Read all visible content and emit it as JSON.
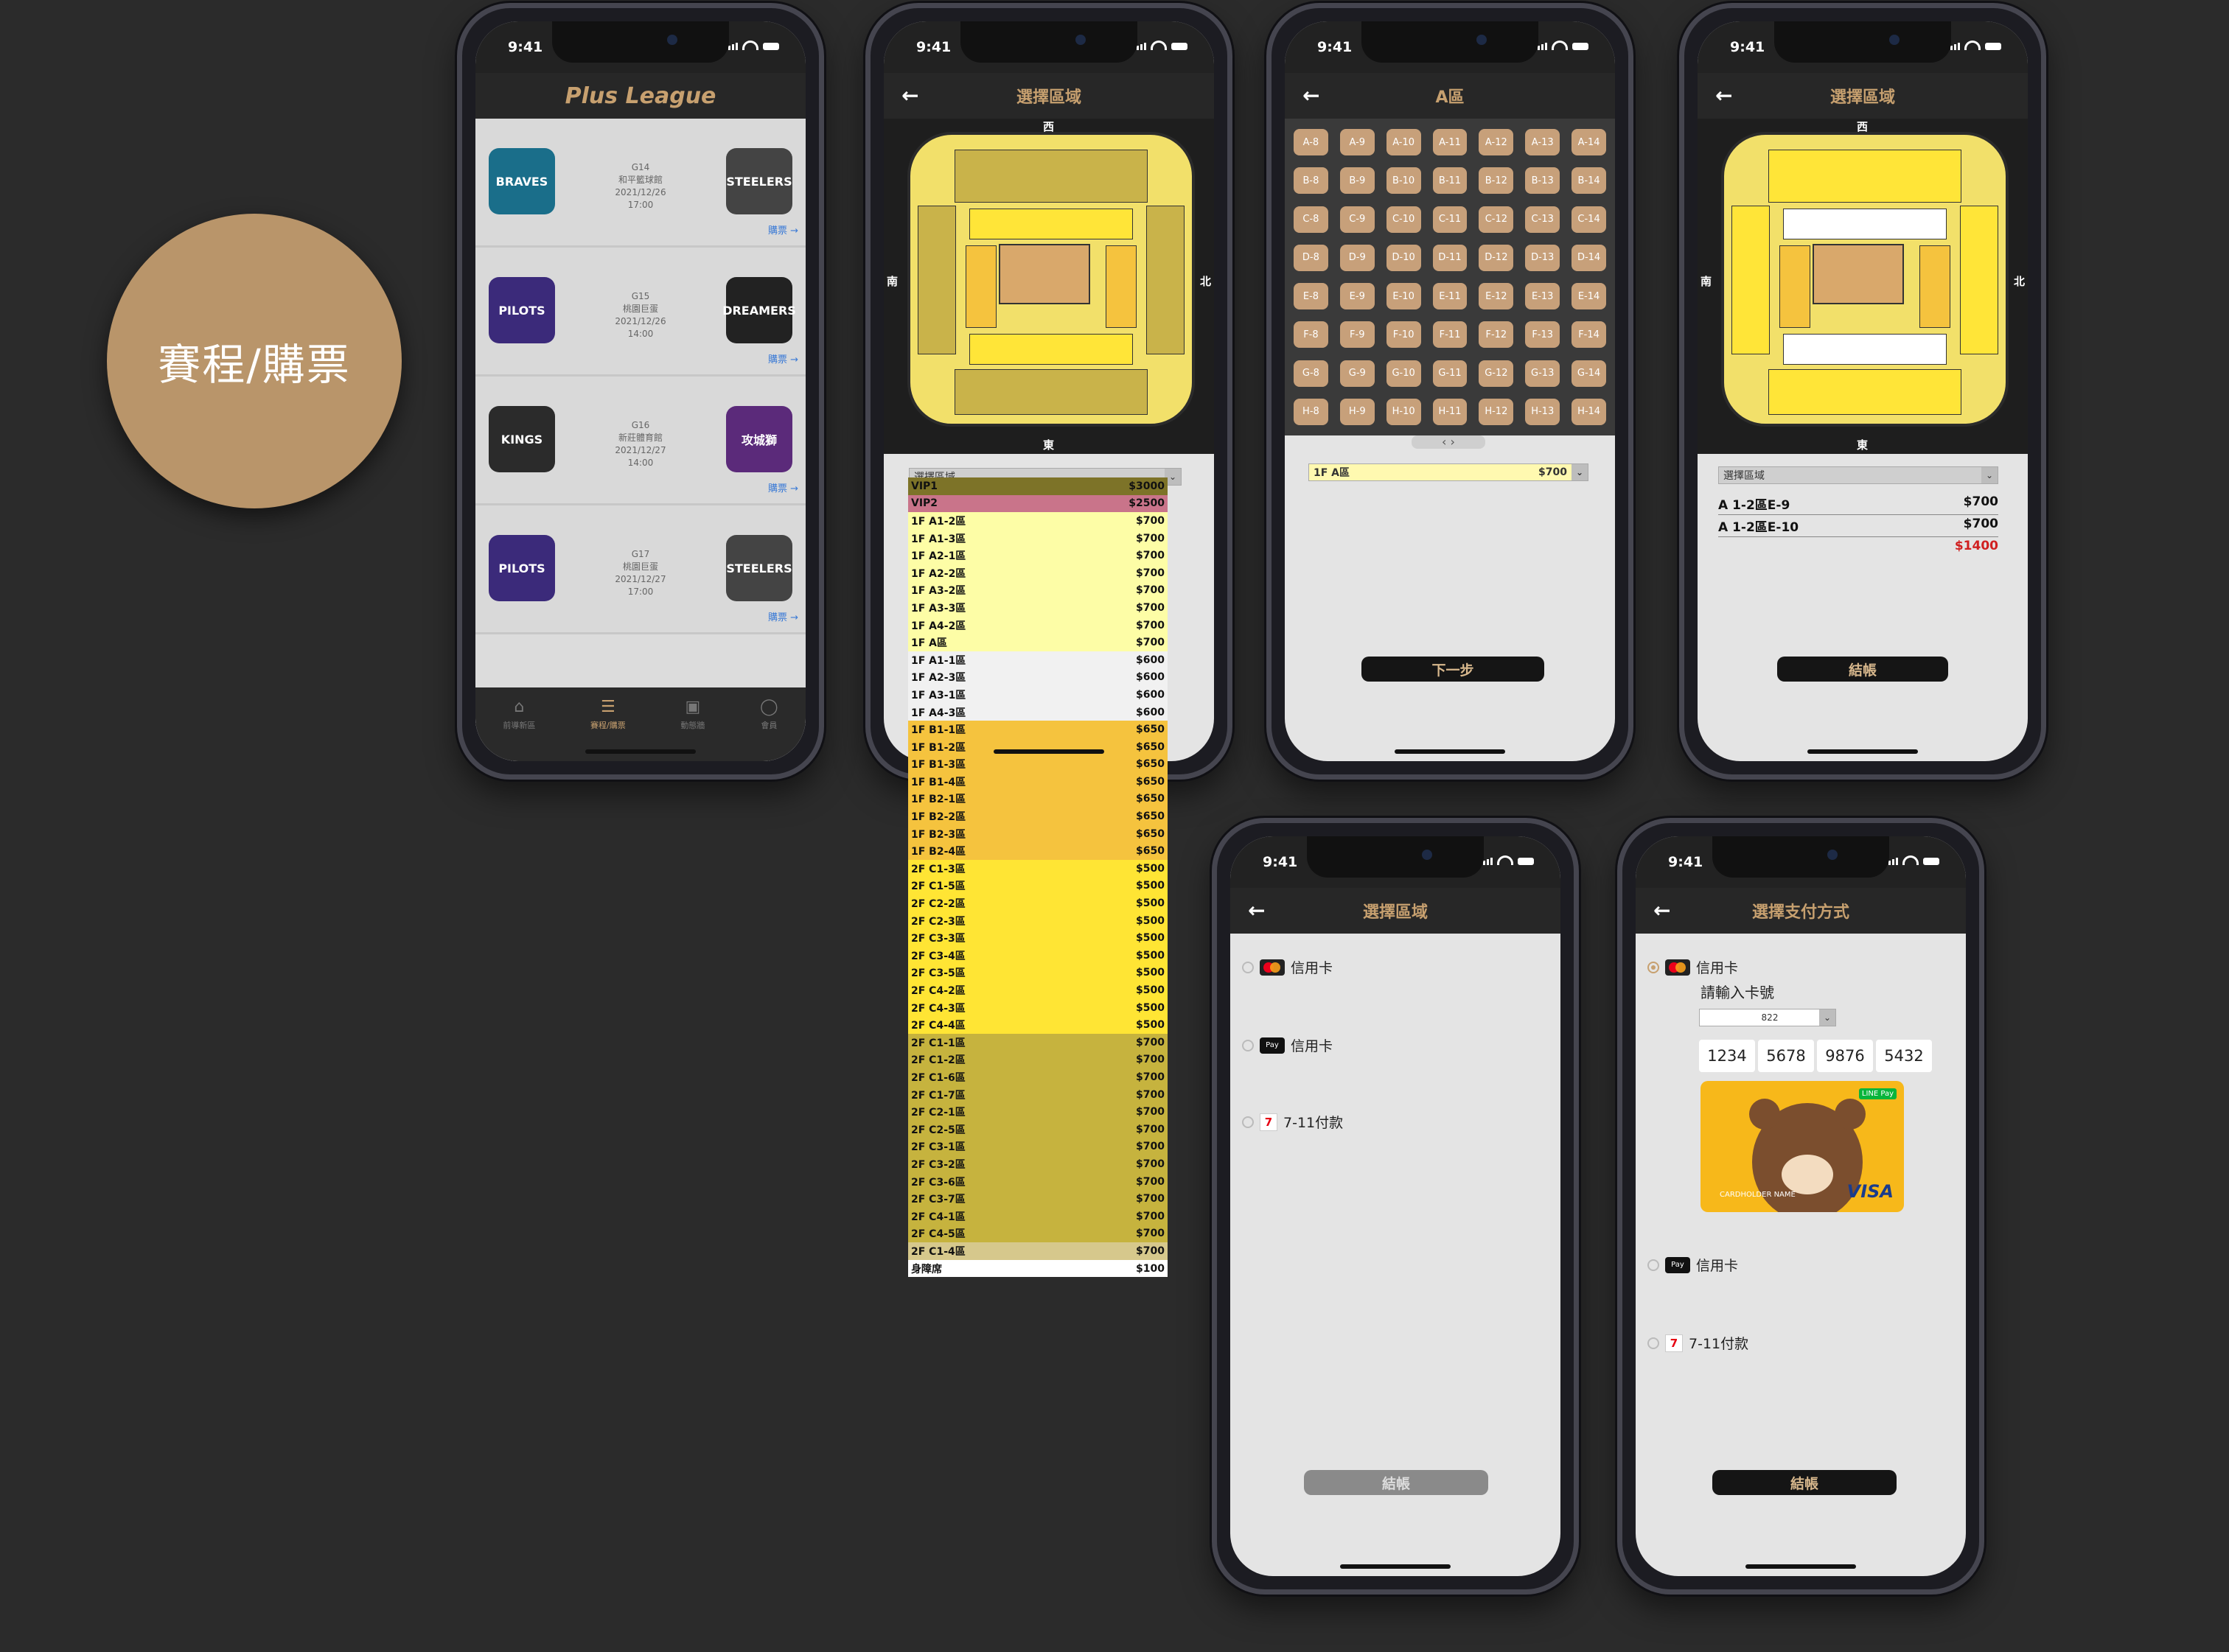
{
  "section_title": "賽程/購票",
  "status_time": "9:41",
  "schedule": {
    "title": "Plus League",
    "buy_label": "購票 →",
    "games": [
      {
        "code": "G14",
        "venue": "和平籃球館",
        "date": "2021/12/26",
        "time": "17:00",
        "home": "BRAVES",
        "away": "STEELERS",
        "home_color": "#1a6e8a",
        "away_color": "#444"
      },
      {
        "code": "G15",
        "venue": "桃園巨蛋",
        "date": "2021/12/26",
        "time": "14:00",
        "home": "PILOTS",
        "away": "DREAMERS",
        "home_color": "#3b2a7a",
        "away_color": "#222"
      },
      {
        "code": "G16",
        "venue": "新莊體育館",
        "date": "2021/12/27",
        "time": "14:00",
        "home": "KINGS",
        "away": "攻城獅",
        "home_color": "#2b2b2b",
        "away_color": "#5b2a7a"
      },
      {
        "code": "G17",
        "venue": "桃園巨蛋",
        "date": "2021/12/27",
        "time": "17:00",
        "home": "PILOTS",
        "away": "STEELERS",
        "home_color": "#3b2a7a",
        "away_color": "#444"
      }
    ],
    "tabs": [
      "前導新區",
      "賽程/購票",
      "動態牆",
      "會員"
    ]
  },
  "zone_select": {
    "title": "選擇區域",
    "dir_west": "西",
    "dir_east": "東",
    "dir_south": "南",
    "dir_north": "北",
    "dropdown": "選擇區域",
    "prices": [
      {
        "name": "VIP1",
        "price": "$3000",
        "color": "#7d7328"
      },
      {
        "name": "VIP2",
        "price": "$2500",
        "color": "#c9748a"
      },
      {
        "name": "1F A1-2區",
        "price": "$700",
        "color": "#fdfda6"
      },
      {
        "name": "1F A1-3區",
        "price": "$700",
        "color": "#fdfda6"
      },
      {
        "name": "1F A2-1區",
        "price": "$700",
        "color": "#fdfda6"
      },
      {
        "name": "1F A2-2區",
        "price": "$700",
        "color": "#fdfda6"
      },
      {
        "name": "1F A3-2區",
        "price": "$700",
        "color": "#fdfda6"
      },
      {
        "name": "1F A3-3區",
        "price": "$700",
        "color": "#fdfda6"
      },
      {
        "name": "1F A4-2區",
        "price": "$700",
        "color": "#fdfda6"
      },
      {
        "name": "1F A區",
        "price": "$700",
        "color": "#fdfda6"
      },
      {
        "name": "1F A1-1區",
        "price": "$600",
        "color": "#f1f1f1"
      },
      {
        "name": "1F A2-3區",
        "price": "$600",
        "color": "#f1f1f1"
      },
      {
        "name": "1F A3-1區",
        "price": "$600",
        "color": "#f1f1f1"
      },
      {
        "name": "1F A4-3區",
        "price": "$600",
        "color": "#f1f1f1"
      },
      {
        "name": "1F B1-1區",
        "price": "$650",
        "color": "#f5c33e"
      },
      {
        "name": "1F B1-2區",
        "price": "$650",
        "color": "#f5c33e"
      },
      {
        "name": "1F B1-3區",
        "price": "$650",
        "color": "#f5c33e"
      },
      {
        "name": "1F B1-4區",
        "price": "$650",
        "color": "#f5c33e"
      },
      {
        "name": "1F B2-1區",
        "price": "$650",
        "color": "#f5c33e"
      },
      {
        "name": "1F B2-2區",
        "price": "$650",
        "color": "#f5c33e"
      },
      {
        "name": "1F B2-3區",
        "price": "$650",
        "color": "#f5c33e"
      },
      {
        "name": "1F B2-4區",
        "price": "$650",
        "color": "#f5c33e"
      },
      {
        "name": "2F C1-3區",
        "price": "$500",
        "color": "#ffe534"
      },
      {
        "name": "2F C1-5區",
        "price": "$500",
        "color": "#ffe534"
      },
      {
        "name": "2F C2-2區",
        "price": "$500",
        "color": "#ffe534"
      },
      {
        "name": "2F C2-3區",
        "price": "$500",
        "color": "#ffe534"
      },
      {
        "name": "2F C3-3區",
        "price": "$500",
        "color": "#ffe534"
      },
      {
        "name": "2F C3-4區",
        "price": "$500",
        "color": "#ffe534"
      },
      {
        "name": "2F C3-5區",
        "price": "$500",
        "color": "#ffe534"
      },
      {
        "name": "2F C4-2區",
        "price": "$500",
        "color": "#ffe534"
      },
      {
        "name": "2F C4-3區",
        "price": "$500",
        "color": "#ffe534"
      },
      {
        "name": "2F C4-4區",
        "price": "$500",
        "color": "#ffe534"
      },
      {
        "name": "2F C1-1區",
        "price": "$700",
        "color": "#c6b33e"
      },
      {
        "name": "2F C1-2區",
        "price": "$700",
        "color": "#c6b33e"
      },
      {
        "name": "2F C1-6區",
        "price": "$700",
        "color": "#c6b33e"
      },
      {
        "name": "2F C1-7區",
        "price": "$700",
        "color": "#c6b33e"
      },
      {
        "name": "2F C2-1區",
        "price": "$700",
        "color": "#c6b33e"
      },
      {
        "name": "2F C2-5區",
        "price": "$700",
        "color": "#c6b33e"
      },
      {
        "name": "2F C3-1區",
        "price": "$700",
        "color": "#c6b33e"
      },
      {
        "name": "2F C3-2區",
        "price": "$700",
        "color": "#c6b33e"
      },
      {
        "name": "2F C3-6區",
        "price": "$700",
        "color": "#c6b33e"
      },
      {
        "name": "2F C3-7區",
        "price": "$700",
        "color": "#c6b33e"
      },
      {
        "name": "2F C4-1區",
        "price": "$700",
        "color": "#c6b33e"
      },
      {
        "name": "2F C4-5區",
        "price": "$700",
        "color": "#c6b33e"
      },
      {
        "name": "2F C1-4區",
        "price": "$700",
        "color": "#d6c88c"
      },
      {
        "name": "身障席",
        "price": "$100",
        "color": "#ffffff"
      }
    ]
  },
  "seat_select": {
    "title": "A區",
    "seats": [
      "A-8",
      "A-9",
      "A-10",
      "A-11",
      "A-12",
      "A-13",
      "A-14",
      "B-8",
      "B-9",
      "B-10",
      "B-11",
      "B-12",
      "B-13",
      "B-14",
      "C-8",
      "C-9",
      "C-10",
      "C-11",
      "C-12",
      "C-13",
      "C-14",
      "D-8",
      "D-9",
      "D-10",
      "D-11",
      "D-12",
      "D-13",
      "D-14",
      "E-8",
      "E-9",
      "E-10",
      "E-11",
      "E-12",
      "E-13",
      "E-14",
      "F-8",
      "F-9",
      "F-10",
      "F-11",
      "F-12",
      "F-13",
      "F-14",
      "G-8",
      "G-9",
      "G-10",
      "G-11",
      "G-12",
      "G-13",
      "G-14",
      "H-8",
      "H-9",
      "H-10",
      "H-11",
      "H-12",
      "H-13",
      "H-14"
    ],
    "pager": "‹   ›",
    "selected_zone": "1F A區",
    "selected_price": "$700",
    "next_label": "下一步"
  },
  "zone_summary": {
    "title": "選擇區域",
    "dropdown": "選擇區域",
    "items": [
      {
        "name": "A 1-2區E-9",
        "price": "$700"
      },
      {
        "name": "A 1-2區E-10",
        "price": "$700"
      }
    ],
    "total": "$1400",
    "checkout": "結帳"
  },
  "payment_empty": {
    "title": "選擇區域",
    "options": [
      "信用卡",
      "信用卡",
      "7-11付款"
    ],
    "checkout": "結帳"
  },
  "payment_filled": {
    "title": "選擇支付方式",
    "card_option": "信用卡",
    "enter_card": "請輸入卡號",
    "bank_code": "822",
    "card_numbers": [
      "1234",
      "5678",
      "9876",
      "5432"
    ],
    "card_holder": "CARDHOLDER NAME",
    "card_brand": "VISA",
    "card_badge": "LINE Pay",
    "options": [
      "信用卡",
      "7-11付款"
    ],
    "checkout": "結帳"
  }
}
